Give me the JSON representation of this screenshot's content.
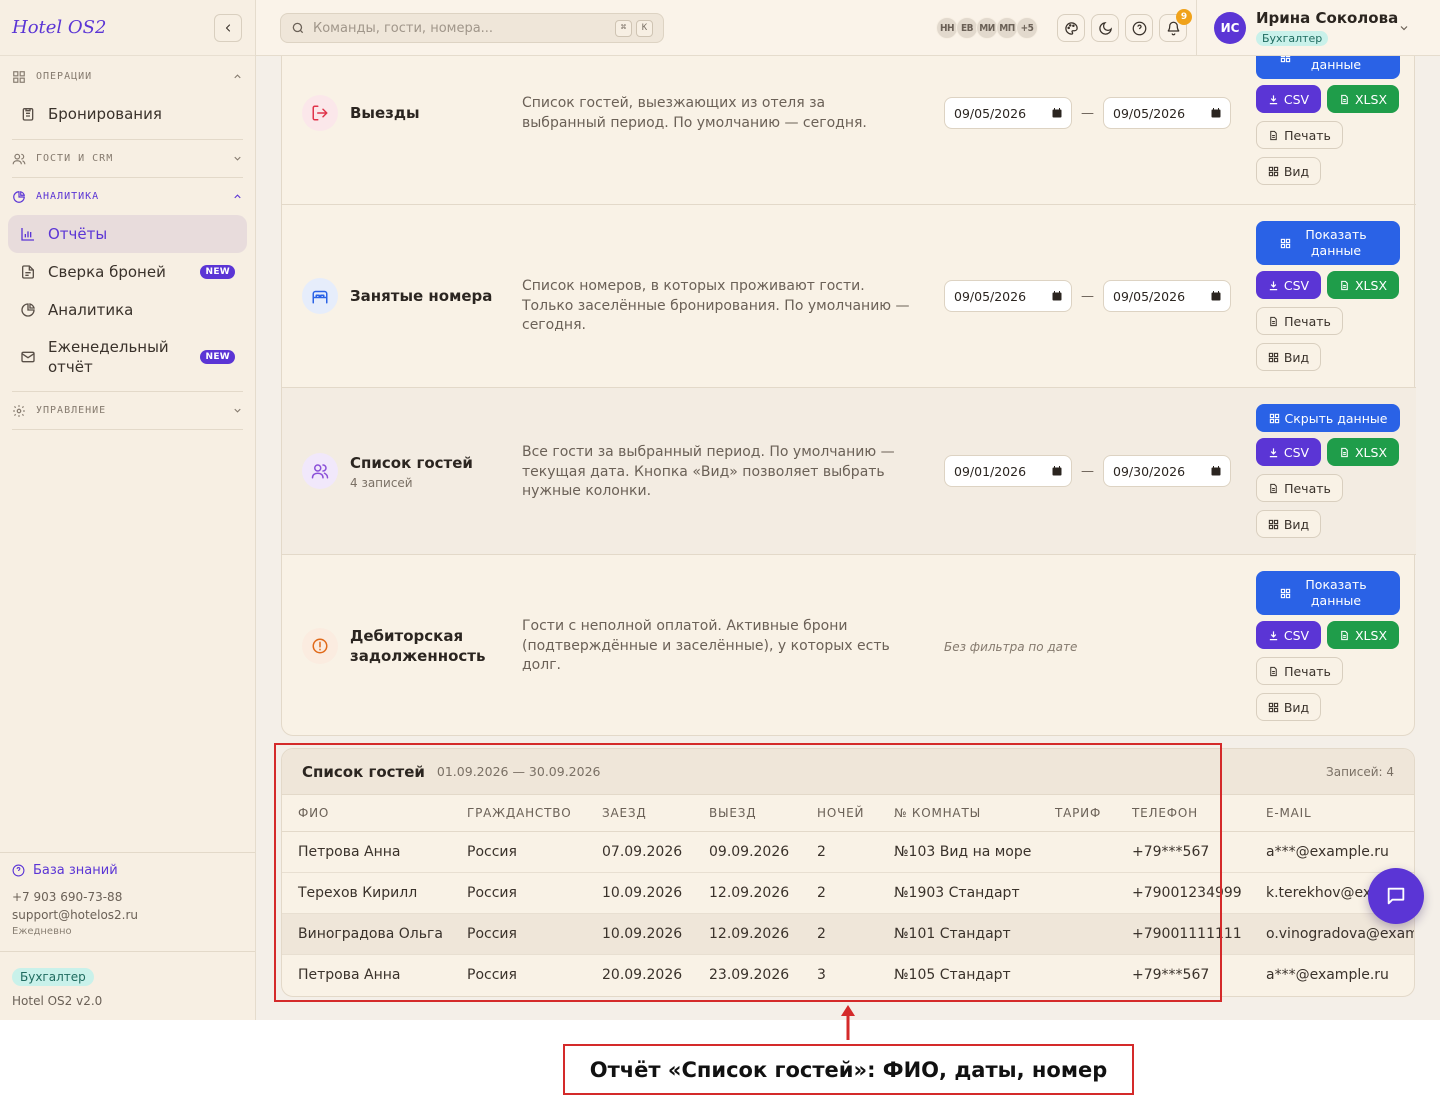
{
  "app": {
    "name": "Hotel OS2"
  },
  "sidebar": {
    "sections": [
      {
        "label": "ОПЕРАЦИИ",
        "items": [
          {
            "label": "Бронирования"
          }
        ]
      },
      {
        "label": "ГОСТИ И CRM",
        "items": []
      },
      {
        "label": "АНАЛИТИКА",
        "items": [
          {
            "label": "Отчёты",
            "active": true
          },
          {
            "label": "Сверка броней",
            "badge": "NEW"
          },
          {
            "label": "Аналитика"
          },
          {
            "label": "Еженедельный отчёт",
            "badge": "NEW"
          }
        ]
      },
      {
        "label": "УПРАВЛЕНИЕ",
        "items": []
      }
    ],
    "footer": {
      "kb_label": "База знаний",
      "phone": "+7 903 690-73-88",
      "email": "support@hotelos2.ru",
      "schedule": "Ежедневно",
      "role": "Бухгалтер",
      "version": "Hotel OS2 v2.0"
    }
  },
  "topbar": {
    "search_placeholder": "Команды, гости, номера...",
    "shortcut_keys": [
      "⌘",
      "K"
    ],
    "presence": [
      "НН",
      "ЕВ",
      "МИ",
      "МП",
      "+5"
    ],
    "notifications_count": "9",
    "user": {
      "initials": "ИС",
      "name": "Ирина Соколова",
      "role": "Бухгалтер"
    }
  },
  "reports": [
    {
      "title": "Выезды",
      "description": "Список гостей, выезжающих из отеля за выбранный период. По умолчанию — сегодня.",
      "date_from": "09/05/2026",
      "date_to": "09/05/2026",
      "toggle_label": "Показать данные",
      "icon": "logout-icon",
      "icon_color": "#e0344b"
    },
    {
      "title": "Занятые номера",
      "description": "Список номеров, в которых проживают гости. Только заселённые бронирования. По умолчанию — сегодня.",
      "date_from": "09/05/2026",
      "date_to": "09/05/2026",
      "toggle_label": "Показать данные",
      "icon": "bed-icon",
      "icon_color": "#2a62e6"
    },
    {
      "title": "Список гостей",
      "subtitle": "4 записей",
      "description": "Все гости за выбранный период. По умолчанию — текущая дата. Кнопка «Вид» позволяет выбрать нужные колонки.",
      "date_from": "09/01/2026",
      "date_to": "09/30/2026",
      "toggle_label": "Скрыть данные",
      "icon": "users-icon",
      "icon_color": "#8a4fd8"
    },
    {
      "title": "Дебиторская задолженность",
      "description": "Гости с неполной оплатой. Активные брони (подтверждённые и заселённые), у которых есть долг.",
      "no_filter": "Без фильтра по дате",
      "toggle_label": "Показать данные",
      "icon": "alert-circle-icon",
      "icon_color": "#e06a1a"
    }
  ],
  "buttons": {
    "csv": "CSV",
    "xlsx": "XLSX",
    "print": "Печать",
    "view": "Вид"
  },
  "guest_list": {
    "title": "Список гостей",
    "range": "01.09.2026 — 30.09.2026",
    "count": "Записей: 4",
    "columns": [
      "ФИО",
      "ГРАЖДАНСТВО",
      "ЗАЕЗД",
      "ВЫЕЗД",
      "НОЧЕЙ",
      "№ КОМНАТЫ",
      "ТАРИФ",
      "ТЕЛЕФОН",
      "E-MAIL"
    ],
    "rows": [
      [
        "Петрова Анна",
        "Россия",
        "07.09.2026",
        "09.09.2026",
        "2",
        "№103 Вид на море",
        "",
        "+79***567",
        "a***@example.ru"
      ],
      [
        "Терехов Кирилл",
        "Россия",
        "10.09.2026",
        "12.09.2026",
        "2",
        "№1903 Стандарт",
        "",
        "+79001234999",
        "k.terekhov@example.ru"
      ],
      [
        "Виноградова Ольга",
        "Россия",
        "10.09.2026",
        "12.09.2026",
        "2",
        "№101 Стандарт",
        "",
        "+79001111111",
        "o.vinogradova@example.ru"
      ],
      [
        "Петрова Анна",
        "Россия",
        "20.09.2026",
        "23.09.2026",
        "3",
        "№105 Стандарт",
        "",
        "+79***567",
        "a***@example.ru"
      ]
    ]
  },
  "annotation": {
    "label": "Отчёт «Список гостей»: ФИО, даты, номер"
  },
  "colors": {
    "accent": "#5b35d5",
    "primary_button": "#2a62e6",
    "csv": "#5b35d5",
    "xlsx": "#1f9d4a",
    "annotation": "#d42a2a"
  }
}
